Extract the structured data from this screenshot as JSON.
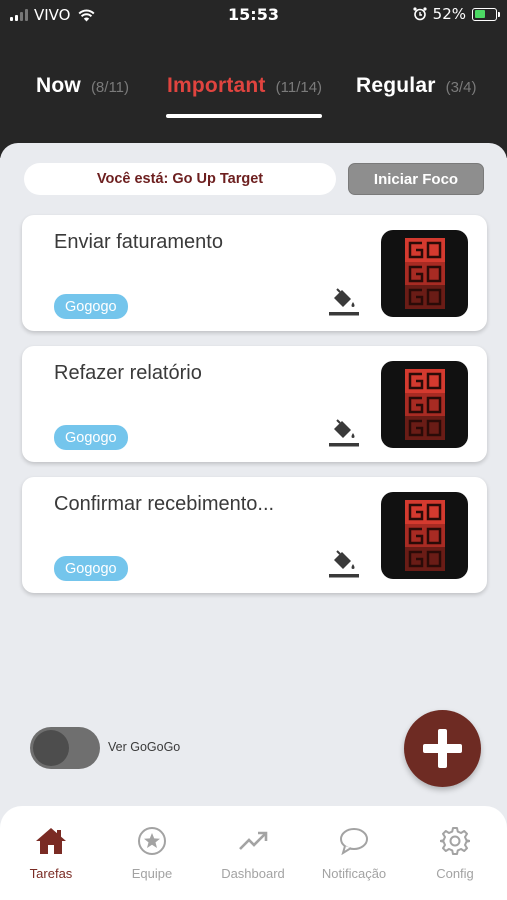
{
  "status_bar": {
    "carrier": "VIVO",
    "time": "15:53",
    "battery": "52%",
    "battery_level": 0.52
  },
  "tabs": [
    {
      "label": "Now",
      "count": "(8/11)",
      "active": false
    },
    {
      "label": "Important",
      "count": "(11/14)",
      "active": true
    },
    {
      "label": "Regular",
      "count": "(3/4)",
      "active": false
    }
  ],
  "header": {
    "target_text": "Você está: Go Up Target",
    "focus_button": "Iniciar Foco"
  },
  "tasks": [
    {
      "title": "Enviar faturamento",
      "tag": "Gogogo",
      "icon": "paint-bucket-icon",
      "thumb": "gogogo-logo"
    },
    {
      "title": "Refazer relatório",
      "tag": "Gogogo",
      "icon": "paint-bucket-icon",
      "thumb": "gogogo-logo"
    },
    {
      "title": "Confirmar recebimento...",
      "tag": "Gogogo",
      "icon": "paint-bucket-icon",
      "thumb": "gogogo-logo"
    }
  ],
  "toggle": {
    "label": "Ver GoGoGo",
    "on": false
  },
  "fab": {
    "icon": "plus-icon",
    "color": "#6e2b23"
  },
  "bottom_nav": [
    {
      "label": "Tarefas",
      "icon": "home-icon",
      "active": true
    },
    {
      "label": "Equipe",
      "icon": "star-badge-icon",
      "active": false
    },
    {
      "label": "Dashboard",
      "icon": "trending-icon",
      "active": false
    },
    {
      "label": "Notificação",
      "icon": "chat-bubble-icon",
      "active": false
    },
    {
      "label": "Config",
      "icon": "gear-icon",
      "active": false
    }
  ],
  "colors": {
    "accent": "#e0443f",
    "brand_dark": "#6e2b23",
    "tag": "#74c5ec",
    "header_bg": "#262626"
  }
}
